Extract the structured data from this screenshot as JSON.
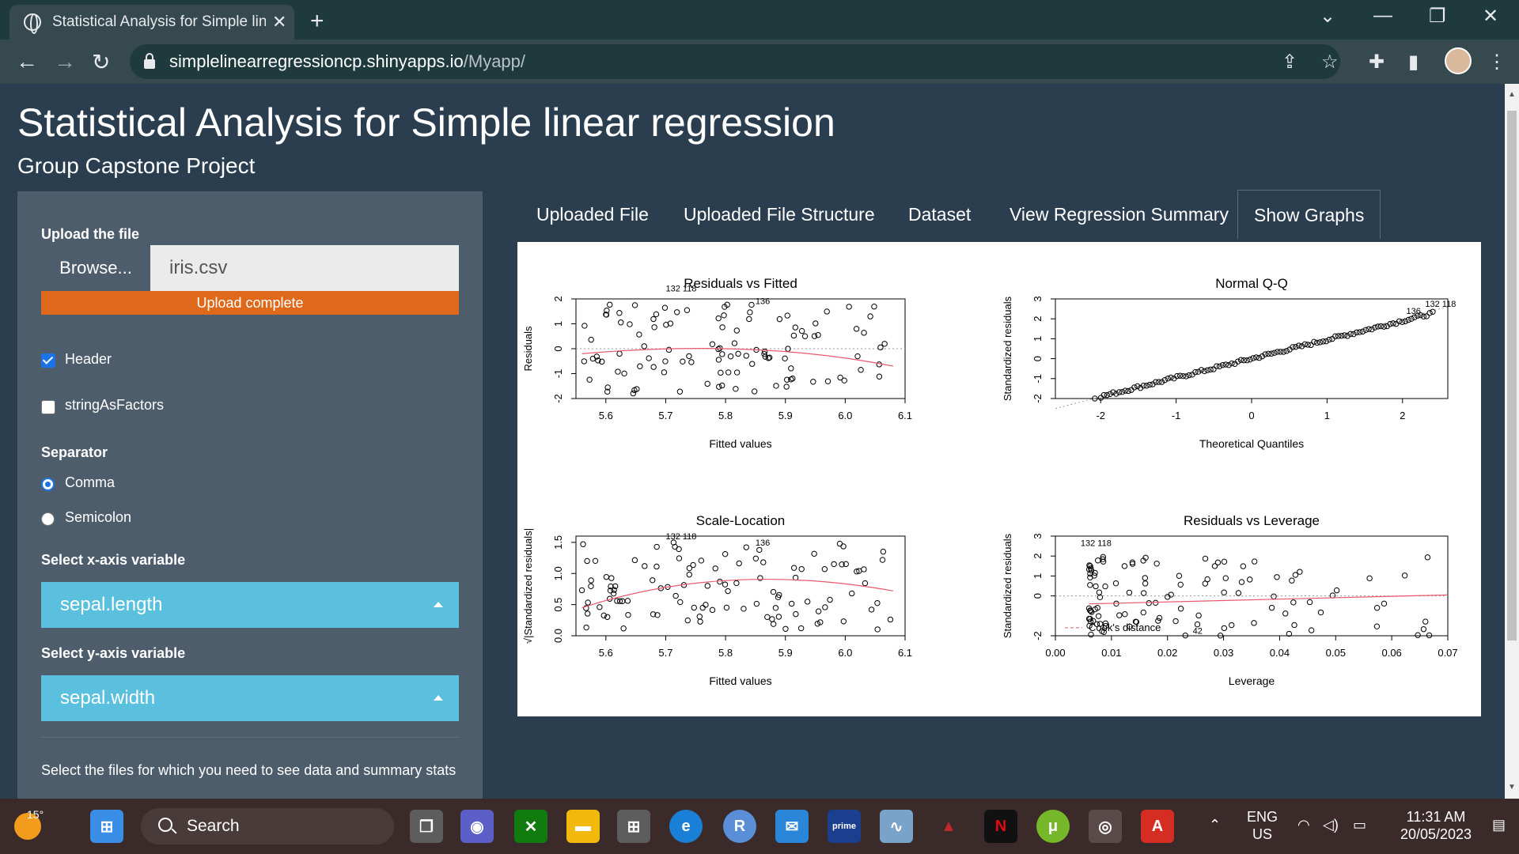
{
  "browser": {
    "tab_title": "Statistical Analysis for Simple line",
    "url_host": "simplelinearregressioncp.shinyapps.io",
    "url_path": "/Myapp/"
  },
  "page": {
    "title": "Statistical Analysis for Simple linear regression",
    "subtitle": "Group Capstone Project"
  },
  "sidebar": {
    "upload_label": "Upload the file",
    "browse_label": "Browse...",
    "file_name": "iris.csv",
    "upload_status": "Upload complete",
    "header_label": "Header",
    "header_checked": true,
    "strings_label": "stringAsFactors",
    "strings_checked": false,
    "separator_label": "Separator",
    "sep_options": [
      "Comma",
      "Semicolon"
    ],
    "sep_selected": "Comma",
    "x_label": "Select x-axis variable",
    "x_value": "sepal.length",
    "y_label": "Select y-axis variable",
    "y_value": "sepal.width",
    "note": "Select the files for which you need to see data and summary stats"
  },
  "tabs": [
    "Uploaded File",
    "Uploaded File Structure",
    "Dataset",
    "View Regression Summary",
    "Show Graphs"
  ],
  "active_tab": "Show Graphs",
  "taskbar": {
    "temperature": "15°",
    "search_label": "Search",
    "language": "ENG",
    "region": "US",
    "time": "11:31 AM",
    "date": "20/05/2023"
  },
  "chart_data": [
    {
      "type": "scatter",
      "title": "Residuals vs Fitted",
      "xlabel": "Fitted values",
      "ylabel": "Residuals",
      "xlim": [
        5.55,
        6.1
      ],
      "ylim": [
        -2,
        2
      ],
      "x_ticks": [
        "5.6",
        "5.7",
        "5.8",
        "5.9",
        "6.0",
        "6.1"
      ],
      "y_ticks": [
        "-2",
        "-1",
        "0",
        "1",
        "2"
      ],
      "annotations": [
        "132",
        "118",
        "136"
      ]
    },
    {
      "type": "scatter",
      "title": "Normal Q-Q",
      "xlabel": "Theoretical Quantiles",
      "ylabel": "Standardized residuals",
      "xlim": [
        -2.6,
        2.6
      ],
      "ylim": [
        -2,
        3
      ],
      "x_ticks": [
        "-2",
        "-1",
        "0",
        "1",
        "2"
      ],
      "y_ticks": [
        "-2",
        "-1",
        "0",
        "1",
        "2",
        "3"
      ],
      "annotations": [
        "132",
        "118",
        "136"
      ]
    },
    {
      "type": "scatter",
      "title": "Scale-Location",
      "xlabel": "Fitted values",
      "ylabel": "√|Standardized residuals|",
      "xlim": [
        5.55,
        6.1
      ],
      "ylim": [
        0,
        1.6
      ],
      "x_ticks": [
        "5.6",
        "5.7",
        "5.8",
        "5.9",
        "6.0",
        "6.1"
      ],
      "y_ticks": [
        "0.0",
        "0.5",
        "1.0",
        "1.5"
      ],
      "annotations": [
        "132",
        "118",
        "136"
      ]
    },
    {
      "type": "scatter",
      "title": "Residuals vs Leverage",
      "xlabel": "Leverage",
      "ylabel": "Standardized residuals",
      "xlim": [
        0,
        0.07
      ],
      "ylim": [
        -2,
        3
      ],
      "x_ticks": [
        "0.00",
        "0.01",
        "0.02",
        "0.03",
        "0.04",
        "0.05",
        "0.06",
        "0.07"
      ],
      "y_ticks": [
        "-2",
        "0",
        "1",
        "2",
        "3"
      ],
      "legend": "Cook's distance",
      "annotations": [
        "132",
        "118",
        "42"
      ]
    }
  ]
}
